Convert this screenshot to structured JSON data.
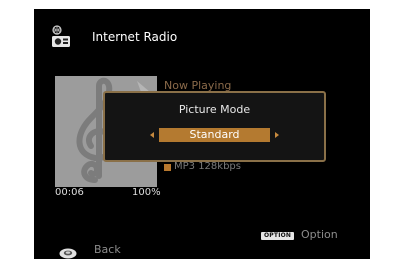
{
  "source": {
    "title": "Internet Radio",
    "icon": "internet-radio-icon"
  },
  "now_playing": {
    "label": "Now Playing",
    "format": "MP3 128kbps"
  },
  "playback": {
    "elapsed": "00:06",
    "buffer": "100%"
  },
  "popup": {
    "title": "Picture Mode",
    "selected": "Standard"
  },
  "footer": {
    "option_button": "OPTION",
    "option_label": "Option",
    "back_label": "Back"
  },
  "colors": {
    "accent": "#b47a30",
    "popup_border": "#8a7048",
    "screen_bg": "#000000"
  }
}
